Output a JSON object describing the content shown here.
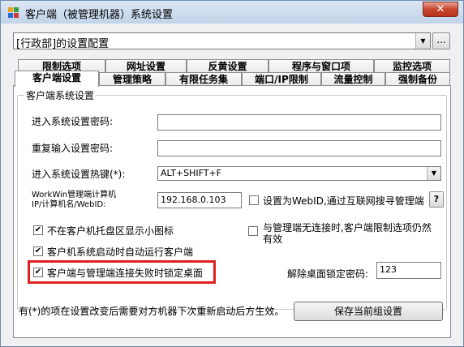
{
  "window": {
    "title": "客户端（被管理机器）系统设置",
    "close_label": "✕"
  },
  "config_selector": {
    "value": "[行政部]的设置配置",
    "ellipsis_label": "..."
  },
  "tabs_row1": [
    "限制选项",
    "网址设置",
    "反黄设置",
    "程序与窗口项",
    "监控选项"
  ],
  "tabs_row2": [
    "客户端设置",
    "管理策略",
    "有限任务集",
    "端口/IP限制",
    "流量控制",
    "强制备份"
  ],
  "active_tab": "客户端设置",
  "group": {
    "title": "客户端系统设置",
    "password_label": "进入系统设置密码:",
    "password_value": "",
    "repeat_password_label": "重复输入设置密码:",
    "repeat_password_value": "",
    "hotkey_label": "进入系统设置热键(*):",
    "hotkey_value": "ALT+SHIFT+F",
    "server_label_line1": "WorkWin管理端计算机",
    "server_label_line2": "IP/计算机名/WebID:",
    "server_value": "192.168.0.103",
    "webid_checkbox_label": "设置为WebID,通过互联网搜寻管理端",
    "webid_checked": false,
    "help_label": "?",
    "hide_tray_label": "不在客户机托盘区显示小图标",
    "hide_tray_checked": true,
    "disconnect_label_line1": "与管理端无连接时,客户端限制选项仍然",
    "disconnect_label_line2": "有效",
    "disconnect_checked": false,
    "autorun_label": "客户机系统启动时自动运行客户端",
    "autorun_checked": true,
    "lock_desktop_label": "客户端与管理端连接失败时锁定桌面",
    "lock_desktop_checked": true,
    "unlock_password_label": "解除桌面锁定密码:",
    "unlock_password_value": "123"
  },
  "footer": {
    "note": "有(*)的项在设置改变后需要对方机器下次重新启动后方生效。",
    "save_label": "保存当前组设置"
  },
  "colors": {
    "highlight": "#e0201f",
    "titlebar": "#c2d4ea",
    "close_button": "#c7452e"
  }
}
